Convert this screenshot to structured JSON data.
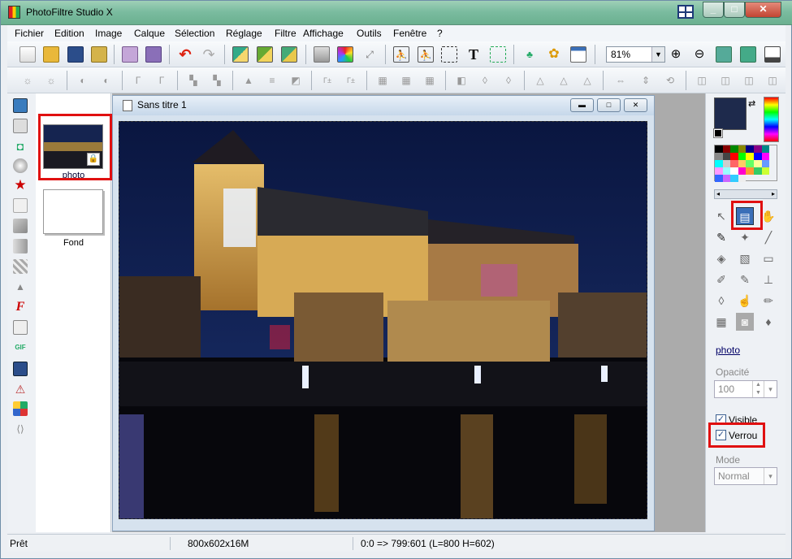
{
  "window": {
    "title": "PhotoFiltre Studio X"
  },
  "menu": [
    "Fichier",
    "Edition",
    "Image",
    "Calque",
    "Sélection",
    "Réglage",
    "Filtre",
    "Affichage",
    "Outils",
    "Fenêtre",
    "?"
  ],
  "toolbar": {
    "zoom": "81%"
  },
  "layers": {
    "items": [
      {
        "name": "photo",
        "locked": true
      },
      {
        "name": "Fond",
        "locked": false
      }
    ]
  },
  "document": {
    "title": "Sans titre 1"
  },
  "panel": {
    "layer_name": "photo",
    "opacity_label": "Opacité",
    "opacity_value": "100",
    "visible_label": "Visible",
    "lock_label": "Verrou",
    "mode_label": "Mode",
    "mode_value": "Normal"
  },
  "status": {
    "ready": "Prêt",
    "size": "800x602x16M",
    "coords": "0:0 => 799:601 (L=800  H=602)"
  },
  "colors": {
    "foreground": "#1e2a4c",
    "highlight": "#e01010",
    "titlebar": "#7bbca0"
  }
}
